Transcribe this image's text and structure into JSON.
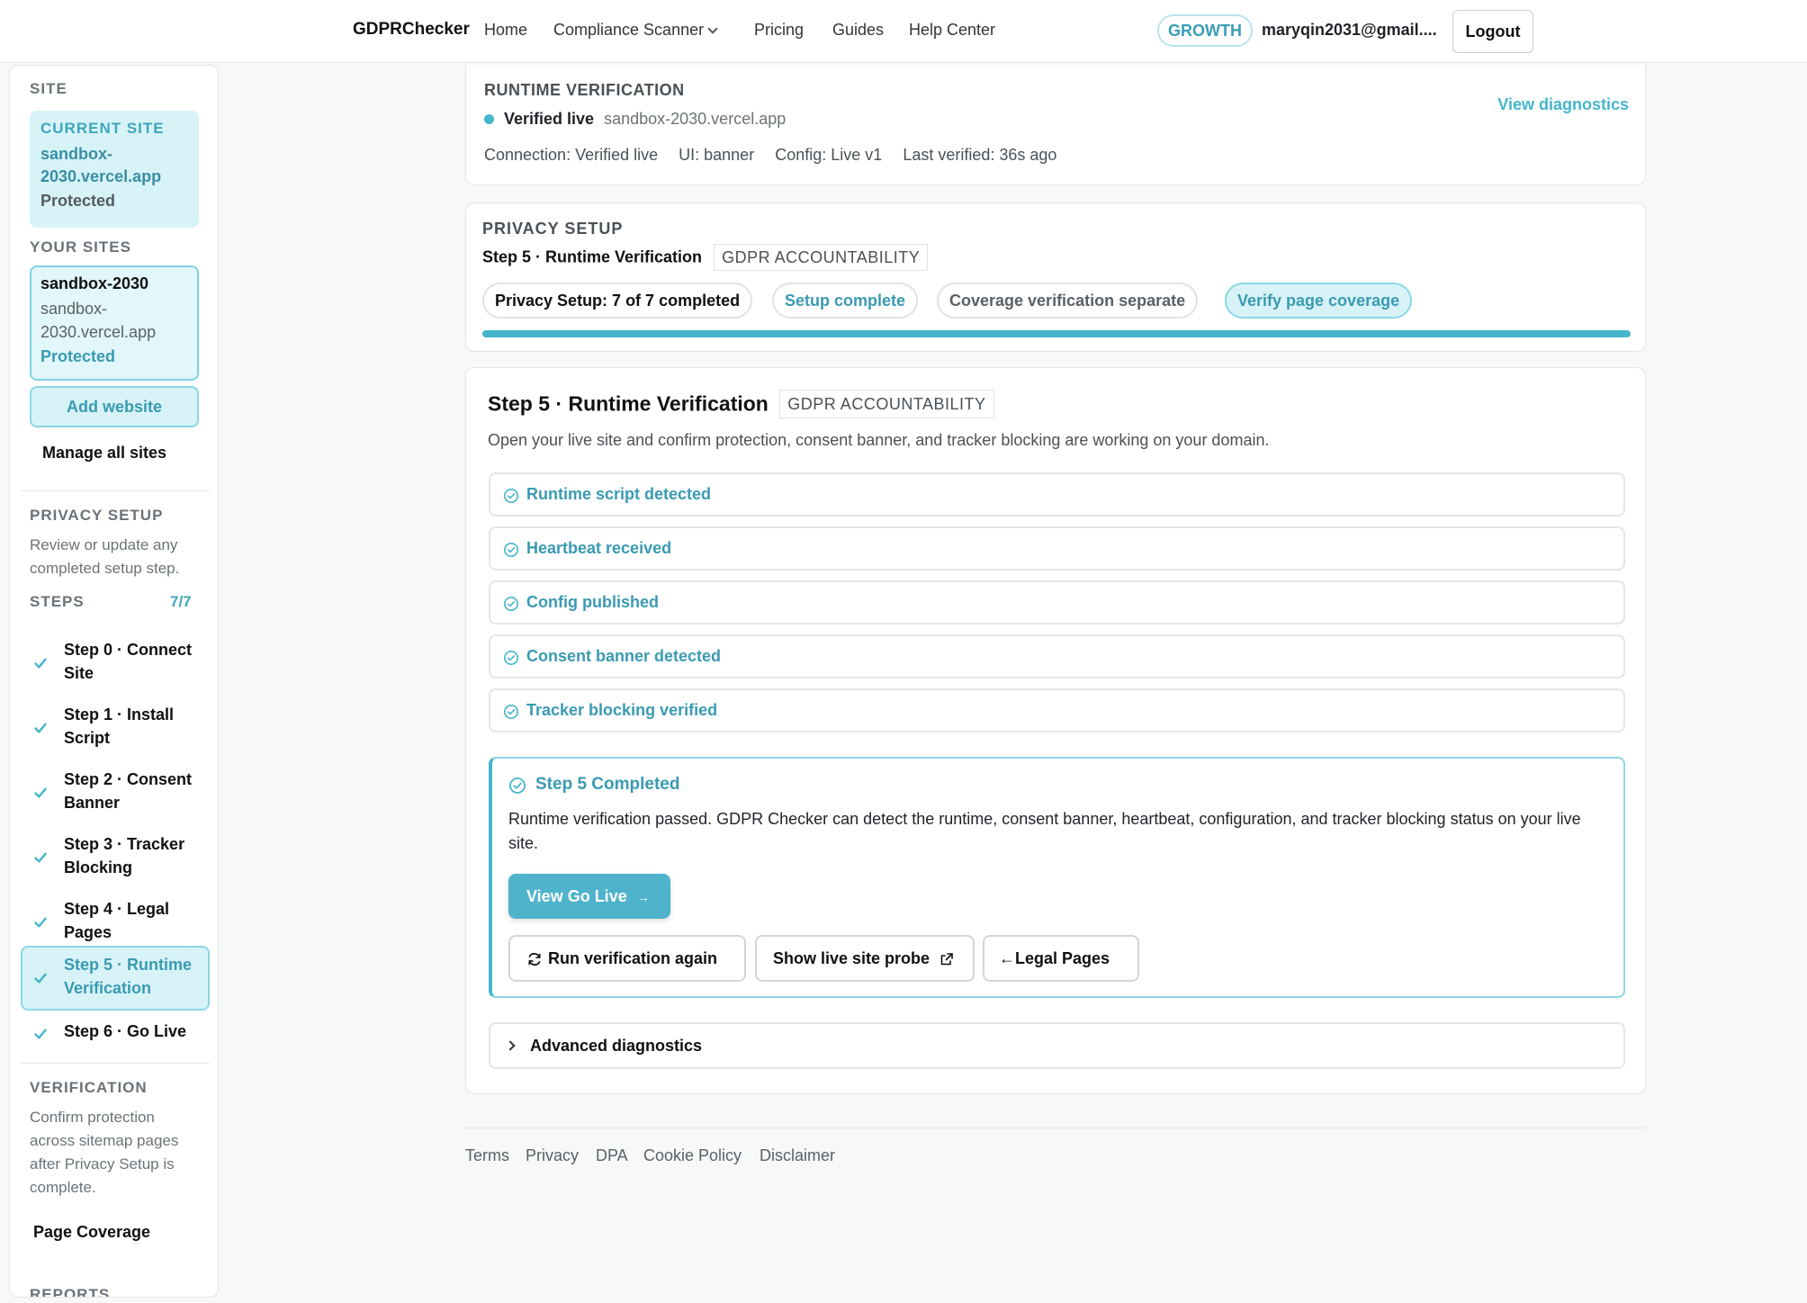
{
  "nav": {
    "brand": "GDPRChecker",
    "links": [
      "Home",
      "Compliance Scanner",
      "Pricing",
      "Guides",
      "Help Center"
    ],
    "plan": "GROWTH",
    "email": "maryqin2031@gmail....",
    "logout": "Logout"
  },
  "sidebar": {
    "site_heading": "SITE",
    "current_site": {
      "label": "CURRENT SITE",
      "domain": "sandbox-2030.vercel.app",
      "status": "Protected"
    },
    "your_sites_heading": "YOUR SITES",
    "site_entry": {
      "name": "sandbox-2030",
      "domain": "sandbox-2030.vercel.app",
      "status": "Protected"
    },
    "add_website": "Add website",
    "manage_all": "Manage all sites",
    "privacy_heading": "PRIVACY SETUP",
    "privacy_text": "Review or update any completed setup step.",
    "steps_heading": "STEPS",
    "steps_count": "7/7",
    "steps": [
      "Step 0 · Connect Site",
      "Step 1 · Install Script",
      "Step 2 · Consent Banner",
      "Step 3 · Tracker Blocking",
      "Step 4 · Legal Pages",
      "Step 5 · Runtime Verification",
      "Step 6 · Go Live"
    ],
    "active_step_index": 5,
    "verification_heading": "VERIFICATION",
    "verification_text": "Confirm protection across sitemap pages after Privacy Setup is complete.",
    "page_coverage": "Page Coverage",
    "reports_heading": "REPORTS"
  },
  "runtime": {
    "title": "RUNTIME VERIFICATION",
    "status": "Verified live",
    "domain": "sandbox-2030.vercel.app",
    "view_diagnostics": "View diagnostics",
    "connection": "Connection: Verified live",
    "ui": "UI: banner",
    "config": "Config: Live v1",
    "last_verified": "Last verified: 36s ago"
  },
  "privacy_setup": {
    "heading": "PRIVACY SETUP",
    "step_title": "Step 5 · Runtime Verification",
    "tag": "GDPR ACCOUNTABILITY",
    "pills": [
      "Privacy Setup: 7 of 7 completed",
      "Setup complete",
      "Coverage verification separate",
      "Verify page coverage"
    ],
    "progress": 1.0
  },
  "step5": {
    "title": "Step 5 · Runtime Verification",
    "tag": "GDPR ACCOUNTABILITY",
    "description": "Open your live site and confirm protection, consent banner, and tracker blocking are working on your domain.",
    "checks": [
      "Runtime script detected",
      "Heartbeat received",
      "Config published",
      "Consent banner detected",
      "Tracker blocking verified"
    ],
    "completed_title": "Step 5 Completed",
    "completed_text": "Runtime verification passed. GDPR Checker can detect the runtime, consent banner, heartbeat, configuration, and tracker blocking status on your live site.",
    "go_live_button": "View Go Live",
    "run_again_button": "Run verification again",
    "probe_button": "Show live site probe",
    "legal_button": "Legal Pages",
    "advanced": "Advanced diagnostics"
  },
  "footer": {
    "links": [
      "Terms",
      "Privacy",
      "DPA",
      "Cookie Policy",
      "Disclaimer"
    ]
  },
  "colors": {
    "accent": "#45b5cc",
    "accent_text": "#3a9ab2",
    "accent_bg": "#d7f3f8"
  }
}
